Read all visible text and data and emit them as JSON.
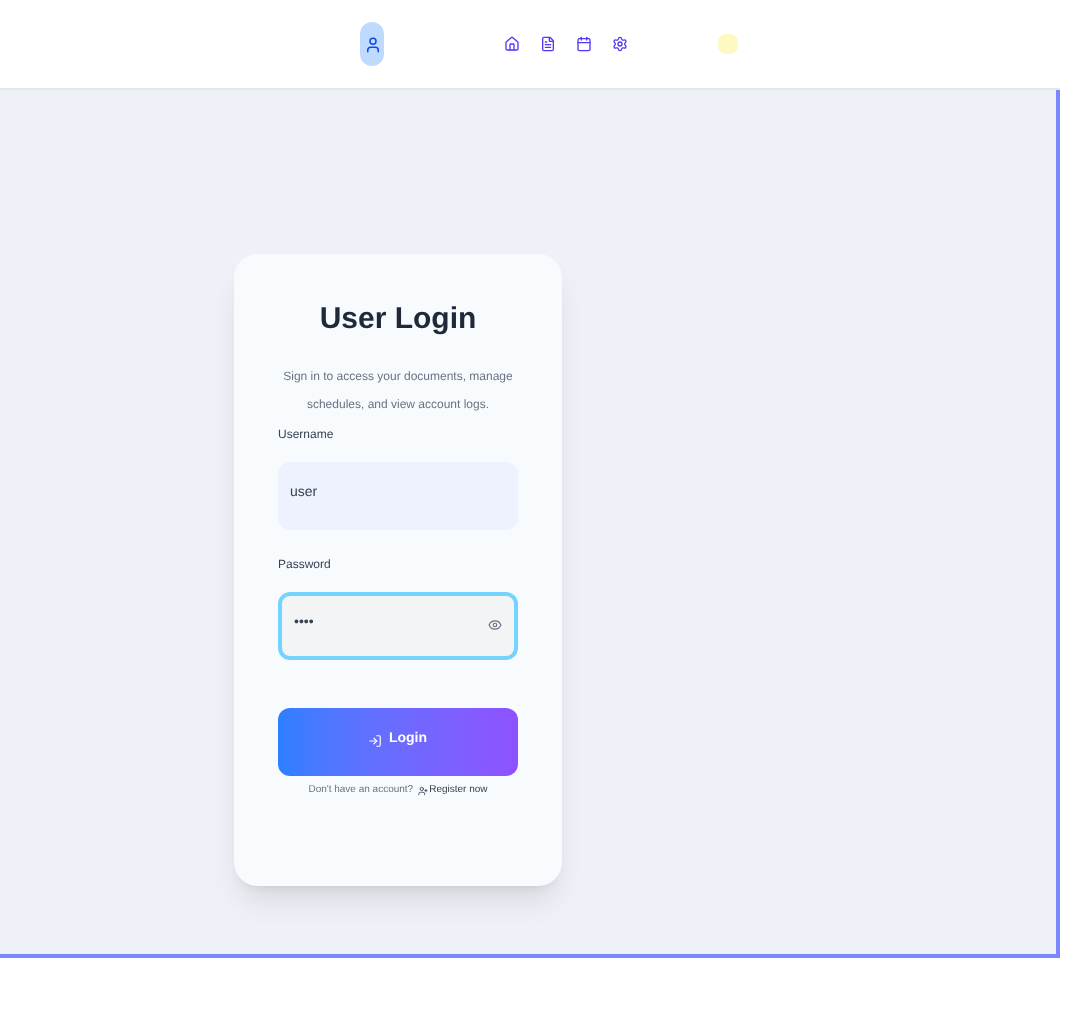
{
  "card": {
    "title": "User Login",
    "subtitle": "Sign in to access your documents, manage schedules, and view account logs.",
    "fields": [
      {
        "label": "Username",
        "value": "user",
        "focused": false,
        "kind": "text"
      },
      {
        "label": "Password",
        "value": "••••",
        "focused": true,
        "kind": "password"
      }
    ],
    "button": "Login",
    "footer": "Don't have an account?",
    "footer_link": "Register now"
  }
}
